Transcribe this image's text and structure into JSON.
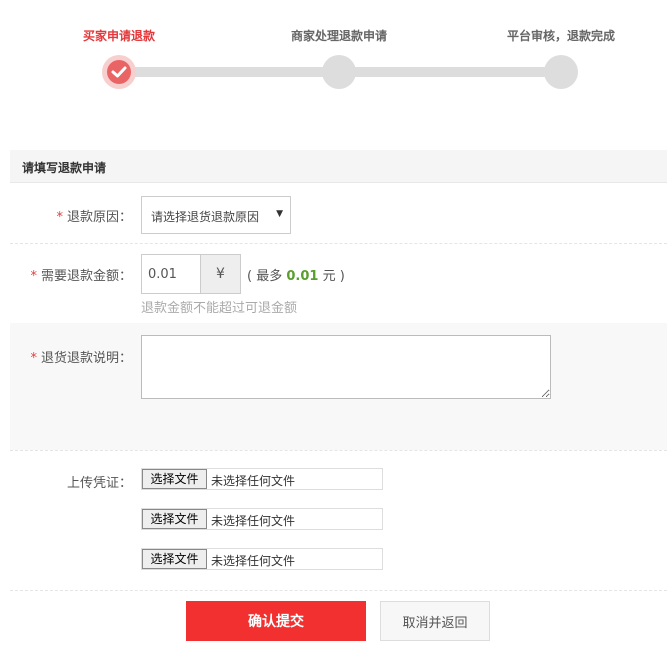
{
  "steps": [
    {
      "label": "买家申请退款",
      "active": true
    },
    {
      "label": "商家处理退款申请",
      "active": false
    },
    {
      "label": "平台审核，退款完成",
      "active": false
    }
  ],
  "section_title": "请填写退款申请",
  "form": {
    "required_mark": "*",
    "reason": {
      "label": "退款原因：",
      "selected": "请选择退货退款原因",
      "arrow": "▼"
    },
    "amount": {
      "label": "需要退款金额：",
      "value": "0.01",
      "currency": "¥",
      "max_prefix": "( 最多",
      "max_value": "0.01",
      "max_suffix": "元 )",
      "hint": "退款金额不能超过可退金额"
    },
    "note": {
      "label": "退货退款说明："
    },
    "upload": {
      "label": "上传凭证：",
      "button_label": "选择文件",
      "status": "未选择任何文件"
    }
  },
  "actions": {
    "submit": "确认提交",
    "cancel": "取消并返回"
  },
  "colors": {
    "accent": "#f23030",
    "step_active": "#e4393c",
    "amount_green": "#5a9f2e"
  }
}
